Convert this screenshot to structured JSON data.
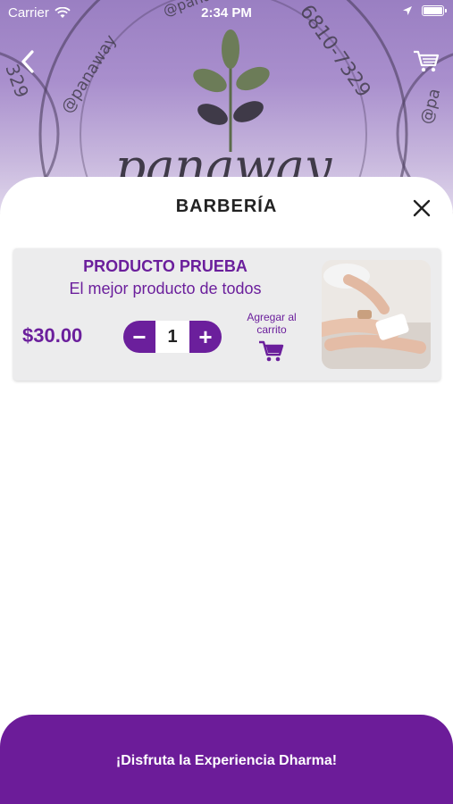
{
  "status_bar": {
    "carrier": "Carrier",
    "time": "2:34 PM"
  },
  "banner": {
    "brand": "panaway",
    "handle_left": "@panaway",
    "handle_top": "@panaway",
    "phone_right": "6810-7329",
    "phone_left": "329",
    "handle_right": "@pa"
  },
  "header": {
    "title": "BARBERÍA"
  },
  "product": {
    "name": "PRODUCTO PRUEBA",
    "description": "El mejor producto de todos",
    "price": "$30.00",
    "quantity": "1",
    "decrement": "−",
    "increment": "+",
    "add_to_cart": "Agregar al carrito"
  },
  "footer": {
    "label": "¡Disfruta la Experiencia Dharma!"
  },
  "colors": {
    "accent": "#6b1f9c",
    "banner": "#9a7fc2",
    "card": "#ececed"
  },
  "icons": [
    "back-icon",
    "cart-icon",
    "close-icon",
    "wifi-icon",
    "location-icon",
    "battery-icon"
  ]
}
